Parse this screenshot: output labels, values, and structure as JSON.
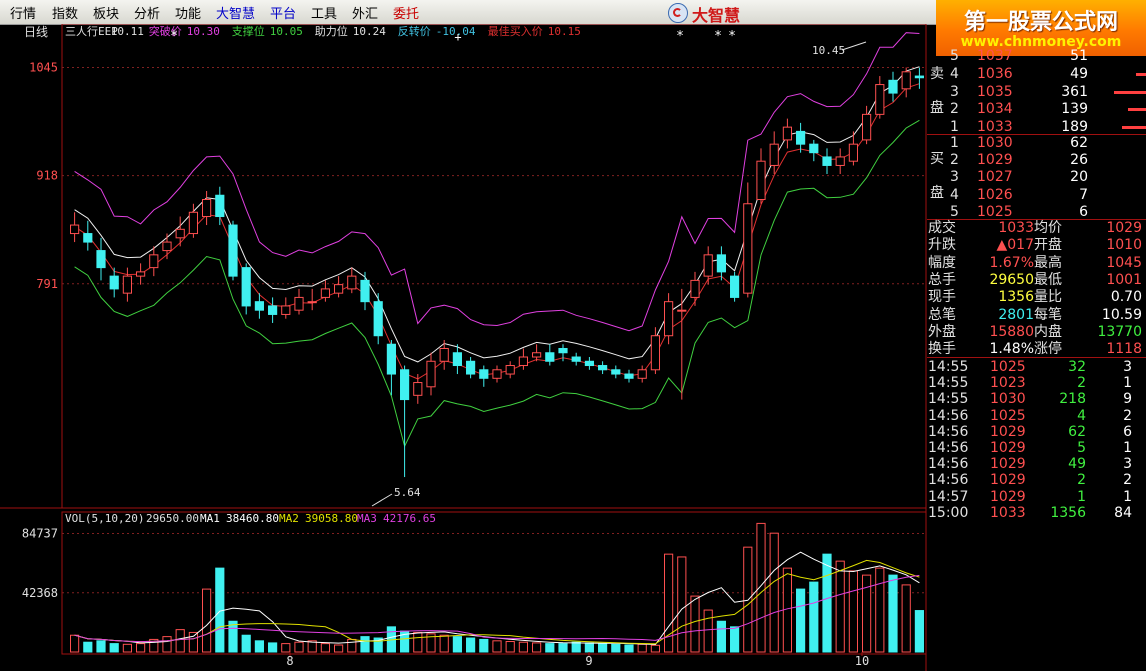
{
  "menu": {
    "items": [
      "行情",
      "指数",
      "板块",
      "分析",
      "功能",
      "大智慧",
      "平台",
      "工具",
      "外汇",
      "委托"
    ],
    "colors": [
      "#000000",
      "#000000",
      "#000000",
      "#000000",
      "#000000",
      "#0000c8",
      "#0000c8",
      "#000000",
      "#000000",
      "#c80000"
    ]
  },
  "brand": {
    "name": "大智慧"
  },
  "watermark": {
    "line1": "第一股票公式网",
    "line2": "www.chnmoney.com"
  },
  "chart": {
    "period_label": "日线",
    "indicator": {
      "name": "三人行EEP",
      "name_value": "10.11",
      "items": [
        {
          "label": "突破价",
          "value": "10.30",
          "color": "#e040e0"
        },
        {
          "label": "支撑位",
          "value": "10.05",
          "color": "#40d040"
        },
        {
          "label": "助力位",
          "value": "10.24",
          "color": "#e0e0e0"
        },
        {
          "label": "反转价",
          "value": "-10.04",
          "color": "#40c0e0"
        },
        {
          "label": "最佳买入价",
          "value": "10.15",
          "color": "#e03030"
        }
      ]
    },
    "price_axis_labels": [
      "1045",
      "918",
      "791"
    ],
    "volume_axis_labels": [
      "84737",
      "42368"
    ],
    "high_annotation": "10.45",
    "low_annotation": "5.64",
    "date_labels": [
      "8",
      "9",
      "10"
    ],
    "volume_header": {
      "title": "VOL(5,10,20)",
      "vol_value": "29650.00",
      "ma1_label": "MA1",
      "ma1_value": "38460.80",
      "ma2_label": "MA2",
      "ma2_value": "39058.80",
      "ma3_label": "MA3",
      "ma3_value": "42176.65"
    }
  },
  "chart_data": [
    {
      "type": "candlestick",
      "ylim": [
        5.3,
        10.75
      ],
      "note_ticks": [
        "10.45",
        "9.18",
        "7.91"
      ],
      "open": [
        8.5,
        8.5,
        8.3,
        8.0,
        7.8,
        8.0,
        8.1,
        8.3,
        8.45,
        8.5,
        8.7,
        8.95,
        8.6,
        8.1,
        7.7,
        7.65,
        7.55,
        7.6,
        7.7,
        7.75,
        7.8,
        7.85,
        7.95,
        7.7,
        7.2,
        6.9,
        6.6,
        6.7,
        7.0,
        7.1,
        7.0,
        6.9,
        6.8,
        6.85,
        6.95,
        7.05,
        7.1,
        7.15,
        7.05,
        7.0,
        6.95,
        6.9,
        6.85,
        6.8,
        6.9,
        7.3,
        7.6,
        7.75,
        8.0,
        8.25,
        8.0,
        7.8,
        8.9,
        9.3,
        9.6,
        9.7,
        9.55,
        9.4,
        9.3,
        9.35,
        9.6,
        9.9,
        10.3,
        10.2,
        10.35
      ],
      "close": [
        8.6,
        8.4,
        8.1,
        7.85,
        8.0,
        8.05,
        8.25,
        8.4,
        8.55,
        8.75,
        8.9,
        8.7,
        8.0,
        7.65,
        7.6,
        7.55,
        7.65,
        7.75,
        7.7,
        7.85,
        7.9,
        8.0,
        7.7,
        7.3,
        6.85,
        6.55,
        6.75,
        7.0,
        7.15,
        6.95,
        6.85,
        6.8,
        6.9,
        6.95,
        7.05,
        7.1,
        7.0,
        7.1,
        7.0,
        6.95,
        6.9,
        6.85,
        6.8,
        6.9,
        7.3,
        7.7,
        7.6,
        7.95,
        8.25,
        8.05,
        7.75,
        8.85,
        9.35,
        9.55,
        9.75,
        9.55,
        9.45,
        9.3,
        9.4,
        9.55,
        9.9,
        10.25,
        10.15,
        10.4,
        10.33
      ],
      "high": [
        8.75,
        8.65,
        8.45,
        8.1,
        8.1,
        8.15,
        8.35,
        8.5,
        8.7,
        8.85,
        9.0,
        9.05,
        8.65,
        8.15,
        7.8,
        7.75,
        7.75,
        7.85,
        7.85,
        7.95,
        8.0,
        8.1,
        8.05,
        7.8,
        7.25,
        6.95,
        6.85,
        7.1,
        7.25,
        7.2,
        7.05,
        6.95,
        6.95,
        7.0,
        7.15,
        7.2,
        7.2,
        7.2,
        7.1,
        7.05,
        7.0,
        6.95,
        6.9,
        6.95,
        7.4,
        7.8,
        7.85,
        8.05,
        8.35,
        8.35,
        8.05,
        9.1,
        9.5,
        9.7,
        9.85,
        9.8,
        9.6,
        9.5,
        9.5,
        9.7,
        10.0,
        10.35,
        10.4,
        10.45,
        10.45
      ],
      "low": [
        8.4,
        8.3,
        7.95,
        7.75,
        7.7,
        7.9,
        8.0,
        8.2,
        8.35,
        8.45,
        8.6,
        8.6,
        7.95,
        7.55,
        7.5,
        7.45,
        7.5,
        7.55,
        7.6,
        7.7,
        7.75,
        7.8,
        7.6,
        7.2,
        6.6,
        5.64,
        6.5,
        6.6,
        6.9,
        6.85,
        6.8,
        6.7,
        6.75,
        6.8,
        6.9,
        7.0,
        6.95,
        7.0,
        6.95,
        6.9,
        6.85,
        6.8,
        6.75,
        6.75,
        6.85,
        7.2,
        6.55,
        7.65,
        7.9,
        7.95,
        7.7,
        7.75,
        8.85,
        9.2,
        9.5,
        9.45,
        9.35,
        9.2,
        9.2,
        9.3,
        9.55,
        9.85,
        10.05,
        10.1,
        10.2
      ]
    },
    {
      "type": "bar",
      "series_name": "VOL",
      "ylim": [
        0,
        93000
      ],
      "values": [
        12000,
        7000,
        8000,
        6000,
        5500,
        6000,
        9000,
        11000,
        16000,
        14000,
        45000,
        60000,
        22000,
        12000,
        8000,
        6500,
        6000,
        7000,
        8000,
        6000,
        5000,
        9000,
        11000,
        10000,
        18000,
        15000,
        14000,
        13000,
        12000,
        11000,
        10000,
        9000,
        8000,
        7500,
        7000,
        6500,
        6000,
        6000,
        7000,
        6500,
        6000,
        5500,
        5000,
        5500,
        4800,
        70000,
        68000,
        40000,
        30000,
        22000,
        18000,
        75000,
        92000,
        85000,
        60000,
        45000,
        50000,
        70000,
        65000,
        58000,
        55000,
        60000,
        55000,
        48000,
        29650
      ]
    }
  ],
  "order_book": {
    "sell_label": "卖盘",
    "buy_label": "买盘",
    "sell": [
      {
        "level": "4",
        "price": "1036",
        "vol": "49"
      },
      {
        "level": "3",
        "price": "1035",
        "vol": "361"
      },
      {
        "level": "2",
        "price": "1034",
        "vol": "139"
      },
      {
        "level": "1",
        "price": "1033",
        "vol": "189"
      }
    ],
    "buy": [
      {
        "level": "1",
        "price": "1030",
        "vol": "62"
      },
      {
        "level": "2",
        "price": "1029",
        "vol": "26"
      },
      {
        "level": "3",
        "price": "1027",
        "vol": "20"
      },
      {
        "level": "4",
        "price": "1026",
        "vol": "7"
      },
      {
        "level": "5",
        "price": "1025",
        "vol": "6"
      }
    ]
  },
  "quote": {
    "rows": [
      {
        "l1": "成交",
        "v1": "1033",
        "l2": "均价",
        "v2": "1029"
      },
      {
        "l1": "升跌",
        "v1": "▲017",
        "l2": "开盘",
        "v2": "1010"
      },
      {
        "l1": "幅度",
        "v1": "1.67%",
        "l2": "最高",
        "v2": "1045"
      },
      {
        "l1": "总手",
        "v1": "29650",
        "l2": "最低",
        "v2": "1001"
      },
      {
        "l1": "现手",
        "v1": "1356",
        "l2": "量比",
        "v2": "0.70"
      },
      {
        "l1": "总笔",
        "v1": "2801",
        "l2": "每笔",
        "v2": "10.59"
      },
      {
        "l1": "外盘",
        "v1": "15880",
        "l2": "内盘",
        "v2": "13770"
      },
      {
        "l1": "换手",
        "v1": "1.48%",
        "l2": "涨停",
        "v2": "1118"
      }
    ]
  },
  "ticks": [
    {
      "time": "14:55",
      "price": "1025",
      "vol": "32",
      "n": "3"
    },
    {
      "time": "14:55",
      "price": "1023",
      "vol": "2",
      "n": "1"
    },
    {
      "time": "14:55",
      "price": "1030",
      "vol": "218",
      "n": "9"
    },
    {
      "time": "14:56",
      "price": "1025",
      "vol": "4",
      "n": "2"
    },
    {
      "time": "14:56",
      "price": "1029",
      "vol": "62",
      "n": "6"
    },
    {
      "time": "14:56",
      "price": "1029",
      "vol": "5",
      "n": "1"
    },
    {
      "time": "14:56",
      "price": "1029",
      "vol": "49",
      "n": "3"
    },
    {
      "time": "14:56",
      "price": "1029",
      "vol": "2",
      "n": "2"
    },
    {
      "time": "14:57",
      "price": "1029",
      "vol": "1",
      "n": "1"
    },
    {
      "time": "15:00",
      "price": "1033",
      "vol": "1356",
      "n": "84"
    }
  ],
  "colors": {
    "up": "#ff5050",
    "down": "#40f0f0",
    "vol_ma1": "#ffffff",
    "vol_ma2": "#e0e000",
    "vol_ma3": "#e040e0"
  }
}
